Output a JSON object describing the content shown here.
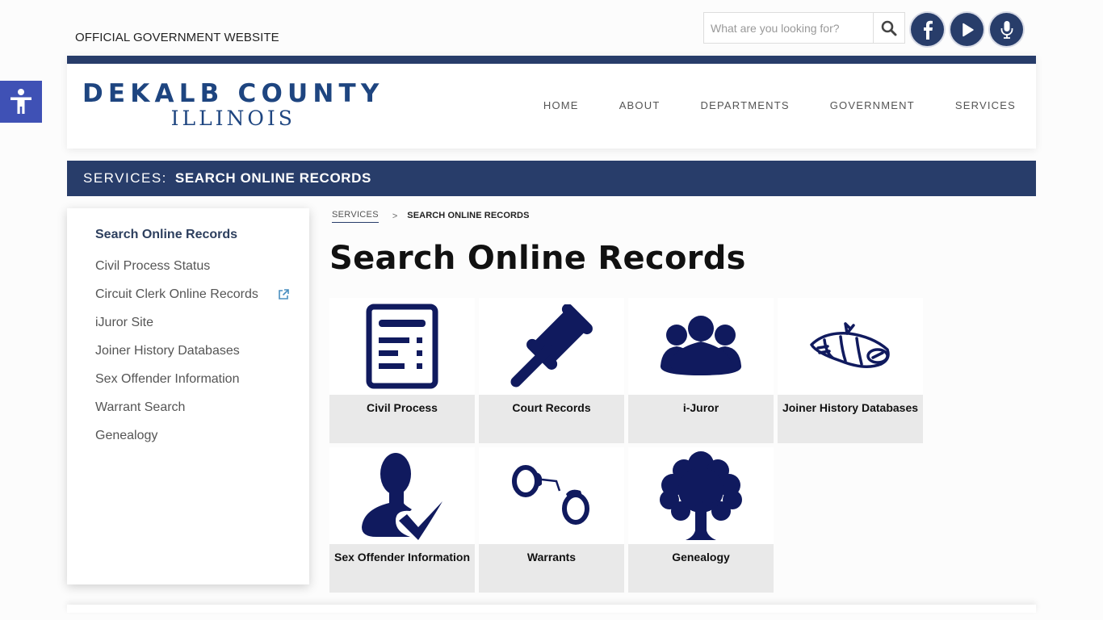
{
  "top": {
    "official_label": "OFFICIAL GOVERNMENT WEBSITE",
    "search_placeholder": "What are you looking for?",
    "search_icon": "search-icon",
    "social": [
      {
        "name": "facebook",
        "icon": "facebook-icon"
      },
      {
        "name": "youtube",
        "icon": "play-icon"
      },
      {
        "name": "podcast",
        "icon": "microphone-icon"
      }
    ],
    "accessibility_icon": "accessibility-icon"
  },
  "header": {
    "logo_line1": "DEKALB COUNTY",
    "logo_line2": "ILLINOIS",
    "nav": [
      "HOME",
      "ABOUT",
      "DEPARTMENTS",
      "GOVERNMENT",
      "SERVICES"
    ]
  },
  "banner": {
    "prefix": "SERVICES:",
    "current": "SEARCH ONLINE RECORDS"
  },
  "sidebar": {
    "title": "Search Online Records",
    "items": [
      {
        "label": "Civil Process Status",
        "external": false
      },
      {
        "label": "Circuit Clerk Online Records",
        "external": true
      },
      {
        "label": "iJuror Site",
        "external": false
      },
      {
        "label": "Joiner History Databases",
        "external": false
      },
      {
        "label": "Sex Offender Information",
        "external": false
      },
      {
        "label": "Warrant Search",
        "external": false
      },
      {
        "label": "Genealogy",
        "external": false
      }
    ]
  },
  "breadcrumb": {
    "parent": "SERVICES",
    "separator": ">",
    "current": "SEARCH ONLINE RECORDS"
  },
  "main": {
    "title": "Search Online Records",
    "tiles": [
      {
        "label": "Civil Process",
        "icon": "document-list-icon"
      },
      {
        "label": "Court Records",
        "icon": "gavel-icon"
      },
      {
        "label": "i-Juror",
        "icon": "group-people-icon"
      },
      {
        "label": "Joiner History Databases",
        "icon": "newspaper-roll-icon"
      },
      {
        "label": "Sex Offender Information",
        "icon": "person-check-icon"
      },
      {
        "label": "Warrants",
        "icon": "handcuffs-icon"
      },
      {
        "label": "Genealogy",
        "icon": "tree-icon"
      }
    ]
  },
  "colors": {
    "brand_navy": "#283d6a",
    "logo_blue": "#1e4580",
    "icon_navy": "#101a5e",
    "accessibility_blue": "#3f51b5",
    "tile_label_bg": "#e9e9e9"
  }
}
